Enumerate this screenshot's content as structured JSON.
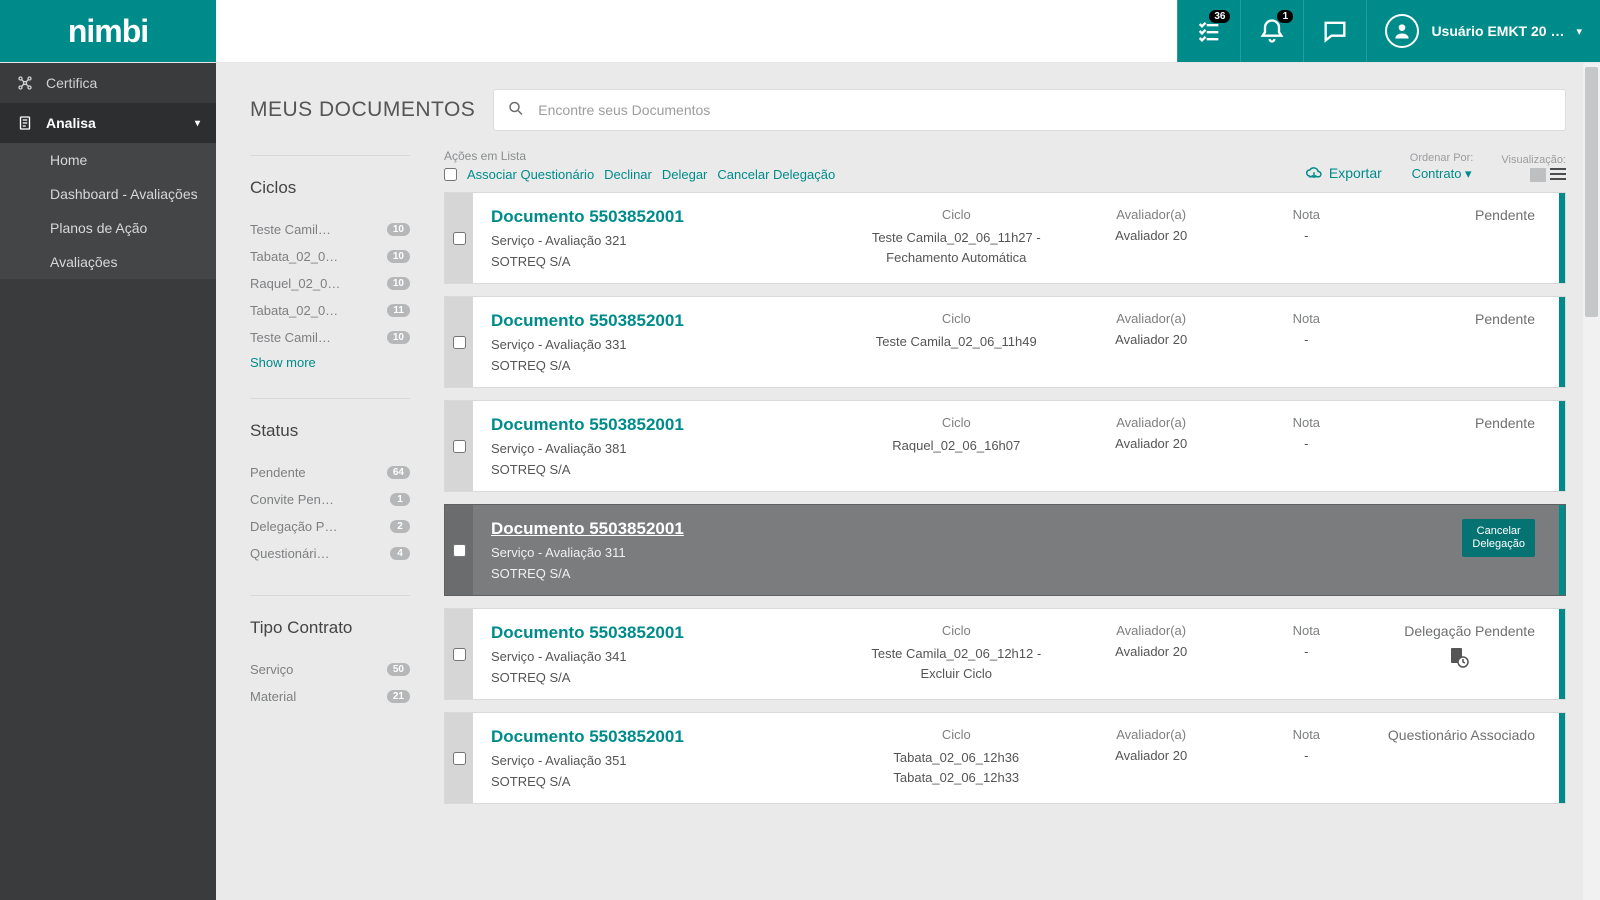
{
  "brand": "nimbi",
  "header": {
    "tasks_badge": "36",
    "notif_badge": "1",
    "user_display": "Usuário EMKT 20 …"
  },
  "sidebar": {
    "certifica": "Certifica",
    "analisa": "Analisa",
    "sub": {
      "home": "Home",
      "dashboard": "Dashboard - Avaliações",
      "planos": "Planos de Ação",
      "avaliacoes": "Avaliações"
    }
  },
  "page": {
    "title": "MEUS DOCUMENTOS",
    "search_placeholder": "Encontre seus Documentos"
  },
  "filters": {
    "ciclos": {
      "title": "Ciclos",
      "items": [
        {
          "label": "Teste Camil…",
          "count": "10"
        },
        {
          "label": "Tabata_02_0…",
          "count": "10"
        },
        {
          "label": "Raquel_02_0…",
          "count": "10"
        },
        {
          "label": "Tabata_02_0…",
          "count": "11"
        },
        {
          "label": "Teste Camil…",
          "count": "10"
        }
      ],
      "show_more": "Show more"
    },
    "status": {
      "title": "Status",
      "items": [
        {
          "label": "Pendente",
          "count": "64"
        },
        {
          "label": "Convite Pen…",
          "count": "1"
        },
        {
          "label": "Delegação P…",
          "count": "2"
        },
        {
          "label": "Questionári…",
          "count": "4"
        }
      ]
    },
    "tipo": {
      "title": "Tipo Contrato",
      "items": [
        {
          "label": "Serviço",
          "count": "50"
        },
        {
          "label": "Material",
          "count": "21"
        }
      ]
    }
  },
  "list_controls": {
    "actions_label": "Ações em Lista",
    "associar": "Associar Questionário",
    "declinar": "Declinar",
    "delegar": "Delegar",
    "cancelar": "Cancelar Delegação",
    "exportar": "Exportar",
    "ordenar_label": "Ordenar Por:",
    "ordenar_value": "Contrato",
    "visual_label": "Visualização:"
  },
  "columns": {
    "ciclo": "Ciclo",
    "avaliador": "Avaliador(a)",
    "nota": "Nota"
  },
  "status_labels": {
    "pendente": "Pendente",
    "cancelar_delegacao": "Cancelar\nDelegação",
    "delegacao_pendente": "Delegação Pendente",
    "questionario_associado": "Questionário Associado"
  },
  "rows": [
    {
      "title": "Documento 5503852001",
      "sub": "Serviço - Avaliação 321",
      "company": "SOTREQ S/A",
      "ciclo": "Teste Camila_02_06_11h27 - Fechamento Automática",
      "avaliador": "Avaliador 20",
      "nota": "-",
      "status": "pendente",
      "selected": false
    },
    {
      "title": "Documento 5503852001",
      "sub": "Serviço - Avaliação 331",
      "company": "SOTREQ S/A",
      "ciclo": "Teste Camila_02_06_11h49",
      "avaliador": "Avaliador 20",
      "nota": "-",
      "status": "pendente",
      "selected": false
    },
    {
      "title": "Documento 5503852001",
      "sub": "Serviço - Avaliação 381",
      "company": "SOTREQ S/A",
      "ciclo": "Raquel_02_06_16h07",
      "avaliador": "Avaliador 20",
      "nota": "-",
      "status": "pendente",
      "selected": false
    },
    {
      "title": "Documento 5503852001",
      "sub": "Serviço - Avaliação 311",
      "company": "SOTREQ S/A",
      "ciclo": "",
      "avaliador": "",
      "nota": "",
      "status": "cancelar_btn",
      "selected": true
    },
    {
      "title": "Documento 5503852001",
      "sub": "Serviço - Avaliação 341",
      "company": "SOTREQ S/A",
      "ciclo": "Teste Camila_02_06_12h12 - Excluir Ciclo",
      "avaliador": "Avaliador 20",
      "nota": "-",
      "status": "delegacao_pendente",
      "selected": false
    },
    {
      "title": "Documento 5503852001",
      "sub": "Serviço - Avaliação 351",
      "company": "SOTREQ S/A",
      "ciclo": "Tabata_02_06_12h36\nTabata_02_06_12h33",
      "avaliador": "Avaliador 20",
      "nota": "-",
      "status": "questionario_associado",
      "selected": false
    }
  ]
}
